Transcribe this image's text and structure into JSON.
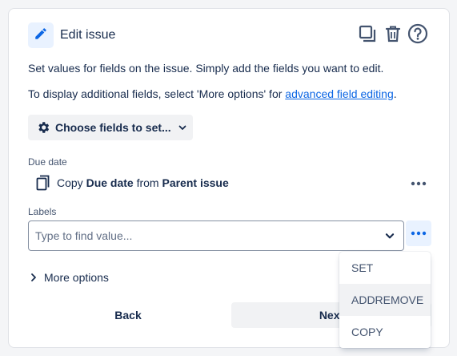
{
  "header": {
    "title": "Edit issue",
    "icons": [
      "pencil-icon",
      "copy-icon",
      "trash-icon",
      "help-icon"
    ]
  },
  "description": {
    "line1": "Set values for fields on the issue. Simply add the fields you want to edit.",
    "line2_prefix": "To display additional fields, select 'More options' for ",
    "line2_link": "advanced field editing",
    "line2_suffix": "."
  },
  "choose_fields": {
    "label": "Choose fields to set..."
  },
  "due_date": {
    "label": "Due date",
    "copy_prefix": "Copy",
    "field_name": "Due date",
    "from_word": "from",
    "source": "Parent issue"
  },
  "labels_field": {
    "label": "Labels",
    "placeholder": "Type to find value..."
  },
  "more_options": {
    "label": "More options"
  },
  "footer": {
    "back_label": "Back",
    "next_label": "Next"
  },
  "menu": {
    "items": [
      "SET",
      "ADDREMOVE",
      "COPY"
    ],
    "hovered": "ADDREMOVE"
  },
  "colors": {
    "accent": "#0c66e4",
    "text": "#172b4d",
    "subtle": "#44546f",
    "button_bg": "#f1f2f4"
  }
}
